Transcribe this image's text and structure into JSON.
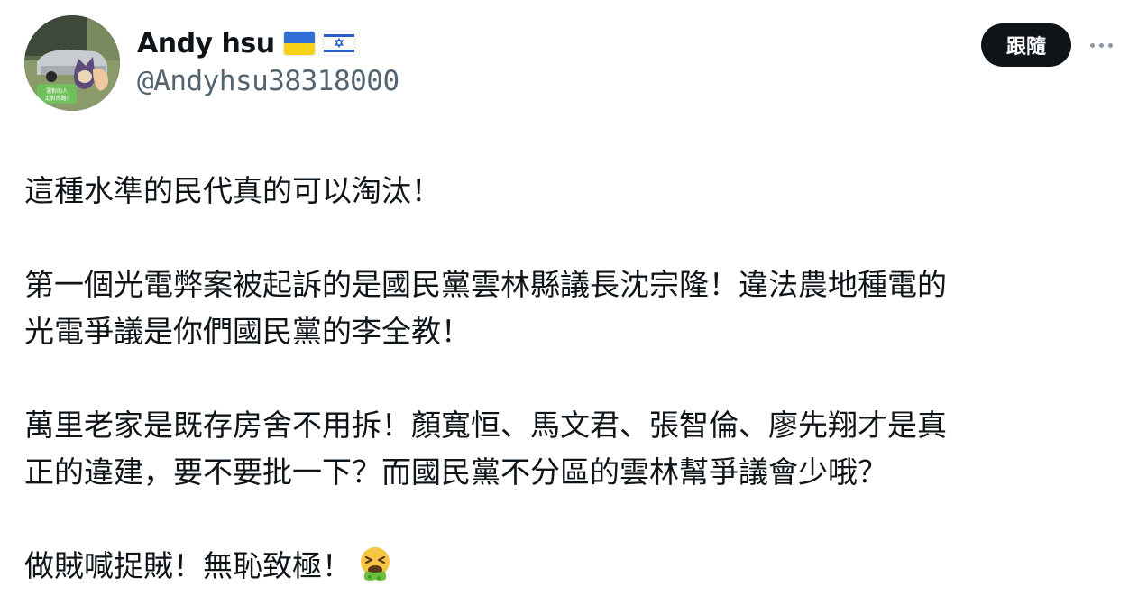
{
  "header": {
    "display_name": "Andy hsu",
    "flags": [
      "ukraine-flag-icon",
      "israel-flag-icon"
    ],
    "handle": "@Andyhsu38318000",
    "follow_label": "跟隨",
    "more_icon": "more-options-icon",
    "avatar_text": "選對的人\n走對的路!"
  },
  "tweet": {
    "paragraphs": [
      "這種水準的民代真的可以淘汰！",
      "第一個光電弊案被起訴的是國民黨雲林縣議長沈宗隆！違法農地種電的\n光電爭議是你們國民黨的李全教！",
      "萬里老家是既存房舍不用拆！顏寬恒、馬文君、張智倫、廖先翔才是真\n正的違建，要不要批一下？而國民黨不分區的雲林幫爭議會少哦？",
      "做賊喊捉賊！無恥致極！"
    ],
    "trailing_emoji": "vomiting-face-emoji"
  },
  "colors": {
    "text_primary": "#0f1419",
    "text_secondary": "#536471",
    "button_bg": "#0f1419",
    "button_text": "#ffffff"
  }
}
